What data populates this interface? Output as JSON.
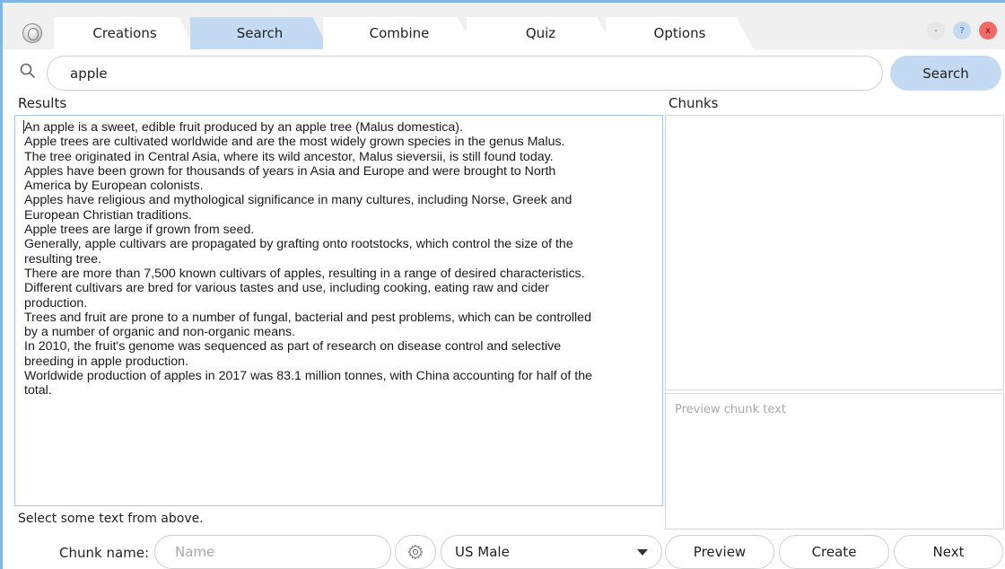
{
  "tabs": [
    {
      "label": "Creations",
      "active": false
    },
    {
      "label": "Search",
      "active": true
    },
    {
      "label": "Combine",
      "active": false
    },
    {
      "label": "Quiz",
      "active": false
    },
    {
      "label": "Options",
      "active": false
    }
  ],
  "window_controls": {
    "minimize": "-",
    "help": "?",
    "close": "x",
    "colors": {
      "minimize": "#e8e8e8",
      "help": "#c4daf3",
      "close": "#f06a6a"
    }
  },
  "search": {
    "value": "apple",
    "button_label": "Search",
    "icon": "search-icon"
  },
  "results": {
    "label": "Results",
    "lines": [
      "An apple is a sweet, edible fruit produced by an apple tree (Malus domestica).",
      "Apple trees are cultivated worldwide and are the most widely grown species in the genus Malus.",
      "The tree originated in Central Asia, where its wild ancestor, Malus sieversii, is still found today.",
      "Apples have been grown for thousands of years in Asia and Europe and were brought to North",
      "America by European colonists.",
      "Apples have religious and mythological significance in many cultures, including Norse, Greek and",
      "European Christian traditions.",
      "Apple trees are large if grown from seed.",
      "Generally, apple cultivars are propagated by grafting onto rootstocks, which control the size of the",
      "resulting tree.",
      "There are more than 7,500 known cultivars of apples, resulting in a range of desired characteristics.",
      "Different cultivars are bred for various tastes and use, including cooking, eating raw and cider",
      "production.",
      "Trees and fruit are prone to a number of fungal, bacterial and pest problems, which can be controlled",
      "by a number of organic and non-organic means.",
      "In 2010, the fruit's genome was sequenced as part of research on disease control and selective",
      "breeding in apple production.",
      "Worldwide production of apples in 2017 was 83.1 million tonnes, with China accounting for half of the",
      "total."
    ]
  },
  "chunks": {
    "label": "Chunks",
    "preview_placeholder": "Preview chunk text"
  },
  "hint": "Select some text from above.",
  "footer": {
    "chunk_name_label": "Chunk name:",
    "name_placeholder": "Name",
    "voice_selected": "US Male",
    "preview_label": "Preview",
    "create_label": "Create",
    "next_label": "Next"
  },
  "colors": {
    "accent": "#c4daf3",
    "frame": "#7fb6e6"
  }
}
